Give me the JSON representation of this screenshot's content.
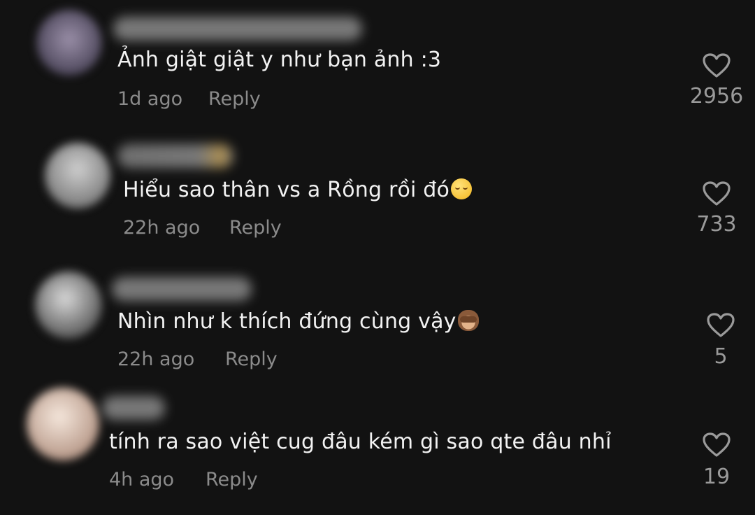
{
  "like_icon": "heart-outline-icon",
  "comments": [
    {
      "text": "Ảnh giật giật y như bạn ảnh :3",
      "emoji": "",
      "time": "1d ago",
      "reply_label": "Reply",
      "likes": "2956"
    },
    {
      "text": "Hiểu sao thân vs a Rồng rồi đó",
      "emoji": "relieved-face-emoji",
      "time": "22h ago",
      "reply_label": "Reply",
      "likes": "733"
    },
    {
      "text": "Nhìn như k thích đứng cùng vậy",
      "emoji": "see-no-evil-monkey-emoji",
      "time": "22h ago",
      "reply_label": "Reply",
      "likes": "5"
    },
    {
      "text": "tính ra sao việt cug đâu kém gì sao qte đâu nhỉ",
      "emoji": "",
      "time": "4h ago",
      "reply_label": "Reply",
      "likes": "19"
    }
  ]
}
